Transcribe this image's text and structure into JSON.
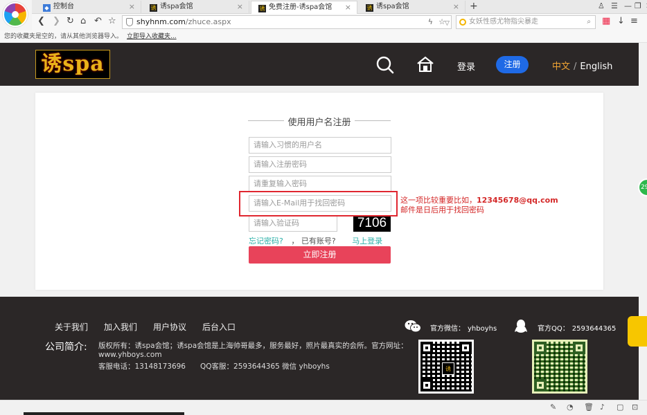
{
  "browser": {
    "tabs": [
      {
        "label": "控制台",
        "icon": "console-icon"
      },
      {
        "label": "诱spa会馆",
        "icon": "site-favicon"
      },
      {
        "label": "免费注册-诱spa会馆",
        "icon": "site-favicon",
        "active": true
      },
      {
        "label": "诱spa会馆",
        "icon": "site-favicon"
      }
    ],
    "url_host": "shyhnm.com",
    "url_path": "/zhuce.aspx",
    "search_placeholder": "女妖性感尤物指尖暴走",
    "bookmarks_empty_text": "您的收藏夹是空的，请从其他浏览器导入。",
    "bookmarks_import_link": "立即导入收藏夹..."
  },
  "header": {
    "logo_text": "诱spa",
    "login_label": "登录",
    "register_label": "注册",
    "lang_zh": "中文",
    "lang_sep": "/",
    "lang_en": "English"
  },
  "form": {
    "title": "使用用户名注册",
    "username_placeholder": "请输入习惯的用户名",
    "password_placeholder": "请输入注册密码",
    "confirm_placeholder": "请重复输入密码",
    "email_placeholder": "请输入E-Mail用于找回密码",
    "captcha_placeholder": "请输入验证码",
    "captcha_code": "7106",
    "forgot_label": "忘记密码?",
    "comma": "，",
    "have_account": "已有账号?",
    "login_now": "马上登录",
    "submit_label": "立即注册"
  },
  "annotation": {
    "line1_prefix": "这一项比较重要比如，",
    "line1_email": "12345678@qq.com",
    "line2": "邮件是日后用于找回密码"
  },
  "footer": {
    "nav": [
      "关于我们",
      "加入我们",
      "用户协议",
      "后台入口"
    ],
    "intro_label": "公司简介:",
    "intro_line1": "版权所有：诱spa会馆；诱spa会馆是上海帅哥最多，服务最好，照片最真实的会所。官方网址：",
    "intro_line2": "www.yhboys.com",
    "intro_line3": "客服电话：13148173696　　QQ客服：2593644365  微信 yhboyhs",
    "wechat_label": "官方微信：",
    "wechat_value": "yhboyhs",
    "qq_label": "官方QQ：",
    "qq_value": "2593644365"
  },
  "colors": {
    "header_bg": "#2b2727",
    "accent_blue": "#1f6ae6",
    "submit_red": "#e8435a",
    "link_teal": "#2bb0a8",
    "lang_orange": "#f1a433",
    "annotation_red": "#d42828"
  }
}
